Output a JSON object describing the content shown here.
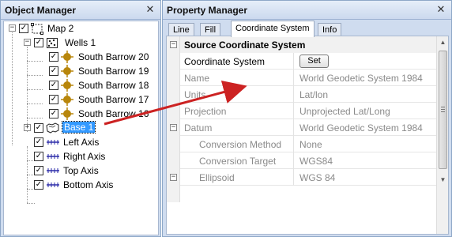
{
  "colors": {
    "accent_selection": "#3399ff",
    "arrow": "#cc2222",
    "point_symbol": "#b8860b",
    "axis_icon": "#2a2aa8"
  },
  "object_manager": {
    "title": "Object Manager",
    "close_icon": "close-icon",
    "tree": [
      {
        "label": "Map 2",
        "icon": "map-frame-icon",
        "checked": true,
        "expander": "−"
      },
      {
        "label": "Wells 1",
        "icon": "point-layer-icon",
        "checked": true,
        "expander": "−"
      },
      {
        "label": "South Barrow 20",
        "icon": "well-symbol-icon",
        "checked": true
      },
      {
        "label": "South Barrow 19",
        "icon": "well-symbol-icon",
        "checked": true
      },
      {
        "label": "South Barrow 18",
        "icon": "well-symbol-icon",
        "checked": true
      },
      {
        "label": "South Barrow 17",
        "icon": "well-symbol-icon",
        "checked": true
      },
      {
        "label": "South Barrow 16",
        "icon": "well-symbol-icon",
        "checked": true
      },
      {
        "label": "Base 1",
        "icon": "base-map-icon",
        "checked": true,
        "expander": "+",
        "selected": true
      },
      {
        "label": "Left Axis",
        "icon": "axis-icon",
        "checked": true
      },
      {
        "label": "Right Axis",
        "icon": "axis-icon",
        "checked": true
      },
      {
        "label": "Top Axis",
        "icon": "axis-icon",
        "checked": true
      },
      {
        "label": "Bottom Axis",
        "icon": "axis-icon",
        "checked": true
      }
    ]
  },
  "property_manager": {
    "title": "Property Manager",
    "close_icon": "close-icon",
    "tabs": [
      "Line",
      "Fill",
      "Coordinate System",
      "Info"
    ],
    "active_tab": "Coordinate System",
    "grid": {
      "category": "Source Coordinate System",
      "rows": [
        {
          "name": "Coordinate System",
          "value": "",
          "button": "Set",
          "enabled": true
        },
        {
          "name": "Name",
          "value": "World Geodetic System 1984",
          "enabled": false
        },
        {
          "name": "Units",
          "value": "Lat/lon",
          "enabled": false
        },
        {
          "name": "Projection",
          "value": "Unprojected Lat/Long",
          "enabled": false
        },
        {
          "name": "Datum",
          "value": "World Geodetic System 1984",
          "enabled": false,
          "expander": "−"
        },
        {
          "name": "Conversion Method",
          "value": "None",
          "enabled": false,
          "indent": 1
        },
        {
          "name": "Conversion Target",
          "value": "WGS84",
          "enabled": false,
          "indent": 1
        },
        {
          "name": "Ellipsoid",
          "value": "WGS 84",
          "enabled": false,
          "indent": 1,
          "expander": "−"
        }
      ]
    }
  }
}
